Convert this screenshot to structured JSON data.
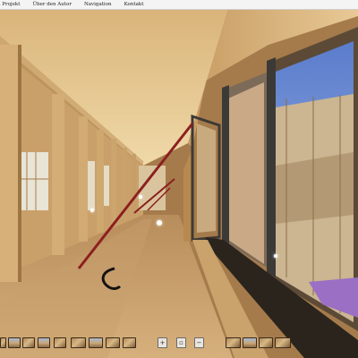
{
  "menu": {
    "items": [
      "n Projekt",
      "Über den Autor",
      "Navigation",
      "Kontakt"
    ]
  },
  "toolbar": {
    "left_thumbnails": 9,
    "center_controls": [
      "zoom-in",
      "fullscreen",
      "zoom-out"
    ],
    "right_thumbnails": 4
  },
  "colors": {
    "wood_light": "#e0bf8a",
    "wood_mid": "#c49a62",
    "wood_dark": "#8a6338",
    "sky": "#6f8fd0",
    "rail_red": "#8c1f1f",
    "purple_tarp": "#9a6fc4"
  }
}
